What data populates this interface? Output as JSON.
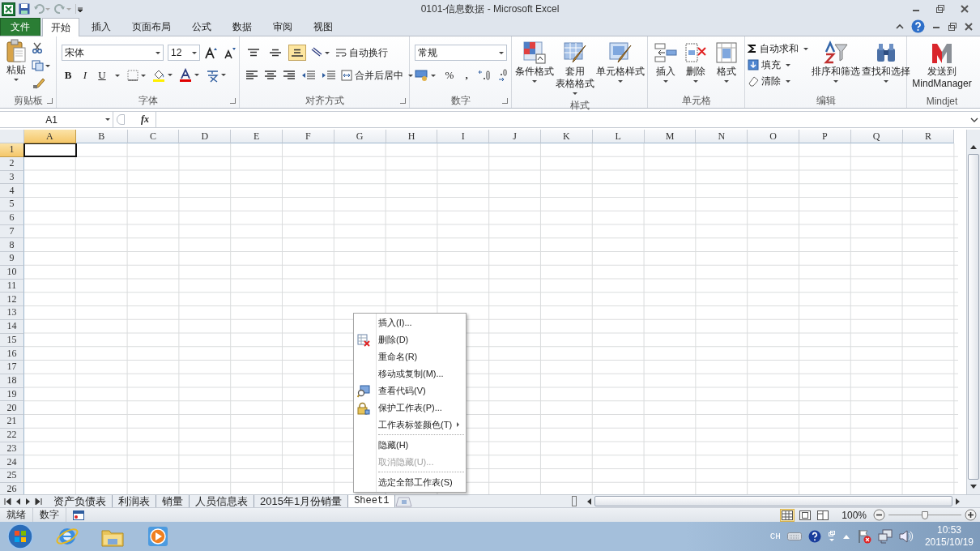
{
  "window": {
    "title": "0101-信息数据  -  Microsoft Excel"
  },
  "ribbon_tabs": [
    {
      "label": "文件",
      "kind": "file",
      "selected": false
    },
    {
      "label": "开始",
      "kind": "tab",
      "selected": true
    },
    {
      "label": "插入",
      "kind": "tab",
      "selected": false
    },
    {
      "label": "页面布局",
      "kind": "tab",
      "selected": false
    },
    {
      "label": "公式",
      "kind": "tab",
      "selected": false
    },
    {
      "label": "数据",
      "kind": "tab",
      "selected": false
    },
    {
      "label": "审阅",
      "kind": "tab",
      "selected": false
    },
    {
      "label": "视图",
      "kind": "tab",
      "selected": false
    }
  ],
  "clipboard": {
    "group": "剪贴板",
    "paste": "粘贴"
  },
  "font": {
    "group": "字体",
    "name": "宋体",
    "size": "12",
    "bold": "B",
    "italic": "I",
    "underline": "U"
  },
  "alignment": {
    "group": "对齐方式",
    "vertical": [
      {
        "kind": "top",
        "selected": false
      },
      {
        "kind": "middle",
        "selected": false
      },
      {
        "kind": "bottom",
        "selected": true
      }
    ],
    "wrap": "自动换行",
    "merge": "合并后居中"
  },
  "number": {
    "group": "数字",
    "format": "常规",
    "percent": "%",
    "comma": ","
  },
  "styles": {
    "group": "样式",
    "buttons": [
      {
        "lines": [
          "条件格式"
        ],
        "kind": "conditional"
      },
      {
        "lines": [
          "套用",
          "表格格式"
        ],
        "kind": "table"
      },
      {
        "lines": [
          "单元格样式"
        ],
        "kind": "cellstyle"
      }
    ]
  },
  "cells": {
    "group": "单元格",
    "buttons": [
      {
        "lines": [
          "插入"
        ],
        "kind": "insert"
      },
      {
        "lines": [
          "删除"
        ],
        "kind": "delete"
      },
      {
        "lines": [
          "格式"
        ],
        "kind": "format"
      }
    ]
  },
  "editing": {
    "group": "编辑",
    "small": [
      {
        "label": "自动求和",
        "kind": "sum"
      },
      {
        "label": "填充",
        "kind": "fill"
      },
      {
        "label": "清除",
        "kind": "clear"
      }
    ],
    "big": [
      {
        "lines": [
          "排序和筛选"
        ],
        "kind": "sort"
      },
      {
        "lines": [
          "查找和选择"
        ],
        "kind": "find"
      }
    ]
  },
  "mindjet": {
    "group": "Mindjet",
    "lines": [
      "发送到",
      "MindManager"
    ],
    "kind": "mindjet"
  },
  "formula_bar": {
    "name_box": "A1",
    "fx": "fx"
  },
  "columns": [
    {
      "label": "A",
      "selected": true
    },
    {
      "label": "B",
      "selected": false
    },
    {
      "label": "C",
      "selected": false
    },
    {
      "label": "D",
      "selected": false
    },
    {
      "label": "E",
      "selected": false
    },
    {
      "label": "F",
      "selected": false
    },
    {
      "label": "G",
      "selected": false
    },
    {
      "label": "H",
      "selected": false
    },
    {
      "label": "I",
      "selected": false
    },
    {
      "label": "J",
      "selected": false
    },
    {
      "label": "K",
      "selected": false
    },
    {
      "label": "L",
      "selected": false
    },
    {
      "label": "M",
      "selected": false
    },
    {
      "label": "N",
      "selected": false
    },
    {
      "label": "O",
      "selected": false
    },
    {
      "label": "P",
      "selected": false
    },
    {
      "label": "Q",
      "selected": false
    },
    {
      "label": "R",
      "selected": false
    }
  ],
  "rows": [
    {
      "label": "1",
      "selected": true
    },
    {
      "label": "2",
      "selected": false
    },
    {
      "label": "3",
      "selected": false
    },
    {
      "label": "4",
      "selected": false
    },
    {
      "label": "5",
      "selected": false
    },
    {
      "label": "6",
      "selected": false
    },
    {
      "label": "7",
      "selected": false
    },
    {
      "label": "8",
      "selected": false
    },
    {
      "label": "9",
      "selected": false
    },
    {
      "label": "10",
      "selected": false
    },
    {
      "label": "11",
      "selected": false
    },
    {
      "label": "12",
      "selected": false
    },
    {
      "label": "13",
      "selected": false
    },
    {
      "label": "14",
      "selected": false
    },
    {
      "label": "15",
      "selected": false
    },
    {
      "label": "16",
      "selected": false
    },
    {
      "label": "17",
      "selected": false
    },
    {
      "label": "18",
      "selected": false
    },
    {
      "label": "19",
      "selected": false
    },
    {
      "label": "20",
      "selected": false
    },
    {
      "label": "21",
      "selected": false
    },
    {
      "label": "22",
      "selected": false
    },
    {
      "label": "23",
      "selected": false
    },
    {
      "label": "24",
      "selected": false
    },
    {
      "label": "25",
      "selected": false
    },
    {
      "label": "26",
      "selected": false
    }
  ],
  "sheet_tabs": [
    {
      "label": "资产负债表",
      "selected": false
    },
    {
      "label": "利润表",
      "selected": false
    },
    {
      "label": "销量",
      "selected": false
    },
    {
      "label": "人员信息表",
      "selected": false
    },
    {
      "label": "2015年1月份销量",
      "selected": false
    },
    {
      "label": "Sheet1",
      "selected": true
    }
  ],
  "context_menu": [
    {
      "label": "插入(I)...",
      "kind": "plain",
      "disabled": false,
      "separator_before": false,
      "submenu": false
    },
    {
      "label": "删除(D)",
      "kind": "delete",
      "disabled": false,
      "separator_before": false,
      "submenu": false
    },
    {
      "label": "重命名(R)",
      "kind": "plain",
      "disabled": false,
      "separator_before": false,
      "submenu": false
    },
    {
      "label": "移动或复制(M)...",
      "kind": "plain",
      "disabled": false,
      "separator_before": false,
      "submenu": false
    },
    {
      "label": "查看代码(V)",
      "kind": "code",
      "disabled": false,
      "separator_before": false,
      "submenu": false
    },
    {
      "label": "保护工作表(P)...",
      "kind": "protect",
      "disabled": false,
      "separator_before": false,
      "submenu": false
    },
    {
      "label": "工作表标签颜色(T)",
      "kind": "plain",
      "disabled": false,
      "separator_before": false,
      "submenu": true
    },
    {
      "label": "隐藏(H)",
      "kind": "plain",
      "disabled": false,
      "separator_before": true,
      "submenu": false
    },
    {
      "label": "取消隐藏(U)...",
      "kind": "plain",
      "disabled": true,
      "separator_before": false,
      "submenu": false
    },
    {
      "label": "选定全部工作表(S)",
      "kind": "plain",
      "disabled": false,
      "separator_before": true,
      "submenu": false
    }
  ],
  "status_bar": {
    "mode": "就绪",
    "num": "数字",
    "views": [
      {
        "kind": "normal",
        "selected": true
      },
      {
        "kind": "layout",
        "selected": false
      },
      {
        "kind": "break",
        "selected": false
      }
    ],
    "zoom": "100%",
    "zoom_slider": {
      "level": 0.5
    }
  },
  "taskbar": {
    "ime": "CH",
    "time": "10:53",
    "date": "2015/10/19"
  }
}
